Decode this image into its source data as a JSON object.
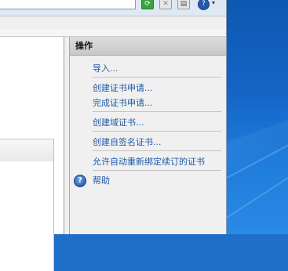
{
  "toolbar": {
    "icons": [
      "refresh-icon",
      "stop-icon",
      "page-icon",
      "help-icon"
    ],
    "help_glyph": "?"
  },
  "actions_pane": {
    "title": "操作",
    "items": [
      {
        "label": "导入..."
      },
      {
        "label": "创建证书申请..."
      },
      {
        "label": "完成证书申请..."
      },
      {
        "label": "创建域证书..."
      },
      {
        "label": "创建自签名证书..."
      },
      {
        "label": "允许自动重新绑定续订的证书"
      },
      {
        "label": "帮助",
        "icon": "help-icon",
        "icon_glyph": "?"
      }
    ]
  },
  "colors": {
    "link": "#1e5aa8",
    "wallpaper": "#1565c7"
  }
}
